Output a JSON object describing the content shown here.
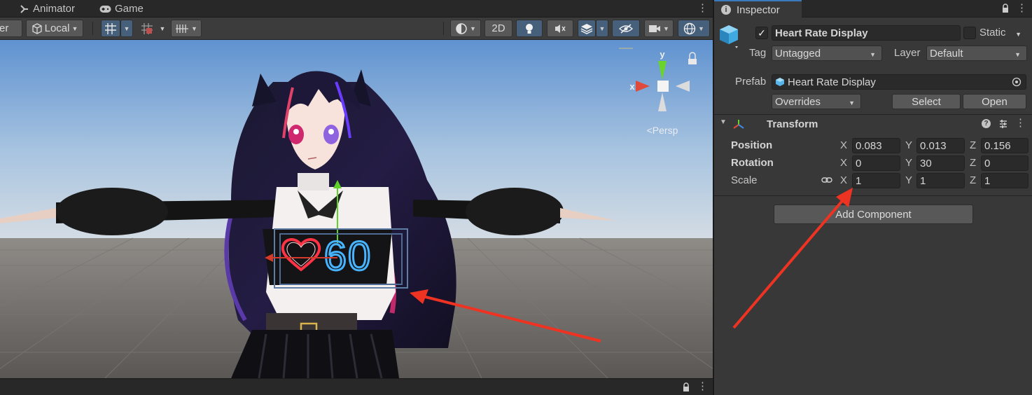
{
  "scene": {
    "tabs": [
      {
        "label": "Animator",
        "icon": "animator-icon"
      },
      {
        "label": "Game",
        "icon": "gamepad-icon"
      }
    ],
    "toolbar": {
      "pivot_partial": "er",
      "space_label": "Local",
      "btn_2d": "2D"
    },
    "gizmo": {
      "y": "y",
      "x": "x",
      "persp": "<Persp"
    },
    "display_digits": "60"
  },
  "inspector": {
    "tab_label": "Inspector",
    "object_name": "Heart Rate Display",
    "active": true,
    "static_label": "Static",
    "tag_label": "Tag",
    "tag_value": "Untagged",
    "layer_label": "Layer",
    "layer_value": "Default",
    "prefab_label": "Prefab",
    "prefab_value": "Heart Rate Display",
    "overrides_label": "Overrides",
    "select_label": "Select",
    "open_label": "Open",
    "transform": {
      "title": "Transform",
      "position_label": "Position",
      "rotation_label": "Rotation",
      "scale_label": "Scale",
      "position": {
        "x": "0.083",
        "y": "0.013",
        "z": "0.156"
      },
      "rotation": {
        "x": "0",
        "y": "30",
        "z": "0"
      },
      "scale": {
        "x": "1",
        "y": "1",
        "z": "1"
      },
      "axis_x": "X",
      "axis_y": "Y",
      "axis_z": "Z"
    },
    "add_component_label": "Add Component"
  },
  "colors": {
    "annotation_arrow": "#ee3322",
    "accent_tab": "#3a79bb",
    "heart_neon": "#ff3344",
    "digits_neon": "#47b4ff"
  }
}
